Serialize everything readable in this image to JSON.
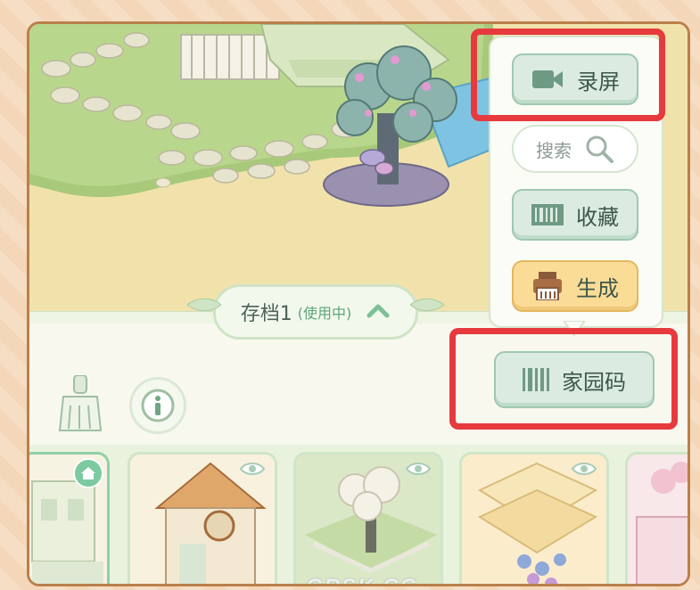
{
  "save_slot": {
    "name": "存档1",
    "status": "(使用中)"
  },
  "menu": {
    "record_label": "录屏",
    "search_placeholder": "搜索",
    "collect_label": "收藏",
    "generate_label": "生成",
    "home_code_label": "家园码"
  },
  "watermark": "GRSK.CC",
  "colors": {
    "highlight": "#e63a3e",
    "button_green": "#dcebe1",
    "button_yellow": "#fbdc97",
    "frame_border": "#b9804c"
  },
  "icons": {
    "record": "video-camera-icon",
    "search": "magnifier-icon",
    "collect": "barcode-icon",
    "generate": "printer-icon",
    "home_code": "barcode-icon",
    "clean": "broom-icon",
    "info": "info-icon",
    "collapse": "chevron-up-icon",
    "preview": "eye-icon",
    "home": "home-icon"
  }
}
